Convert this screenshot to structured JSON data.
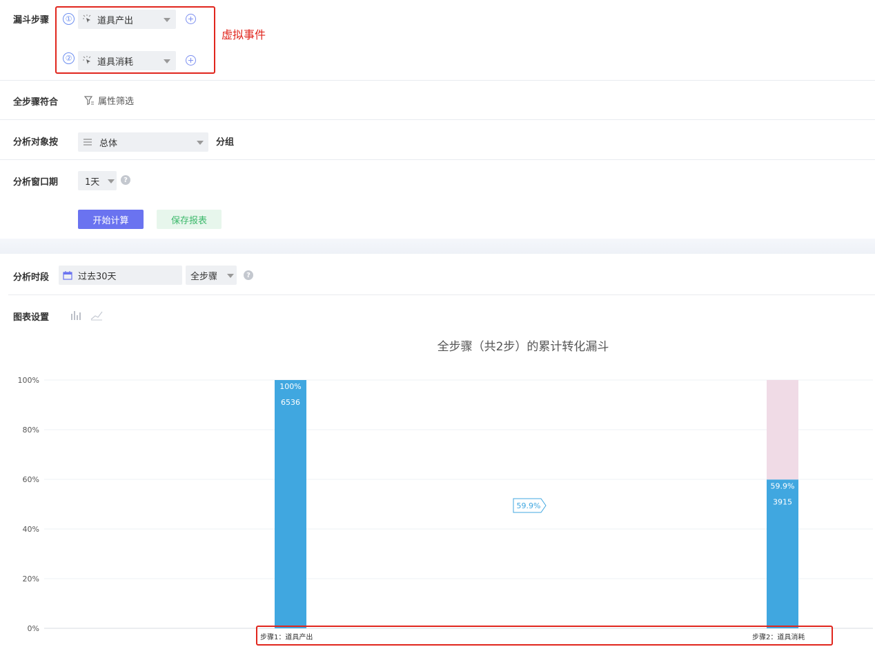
{
  "config": {
    "funnel_steps_label": "漏斗步骤",
    "steps": [
      {
        "index": "①",
        "name": "道具产出",
        "icon": "event-click-icon"
      },
      {
        "index": "②",
        "name": "道具消耗",
        "icon": "event-click-icon"
      }
    ],
    "annotation": "虚拟事件",
    "all_steps_match_label": "全步骤符合",
    "attribute_filter_label": "属性筛选",
    "group_by_label": "分析对象按",
    "group_by_value": "总体",
    "group_suffix": "分组",
    "window_label": "分析窗口期",
    "window_value": "1天",
    "help_glyph": "?",
    "calculate_button": "开始计算",
    "save_button": "保存报表"
  },
  "results": {
    "period_label": "分析时段",
    "period_value": "过去30天",
    "step_scope_value": "全步骤",
    "chart_settings_label": "图表设置"
  },
  "colors": {
    "accent": "#6a73f0",
    "bar": "#40a7e0",
    "bar_remainder": "#f0dbe6",
    "annotation_red": "#e0251c",
    "save_green": "#3bb86a"
  },
  "chart_data": {
    "type": "bar",
    "title": "全步骤（共2步）的累计转化漏斗",
    "categories": [
      "步骤1：道具产出",
      "步骤2：道具消耗"
    ],
    "series": [
      {
        "values": [
          100,
          59.9
        ],
        "counts": [
          6536,
          3915
        ],
        "value_labels": [
          "100%",
          "59.9%"
        ],
        "count_labels": [
          "6536",
          "3915"
        ]
      }
    ],
    "conversion_labels": [
      "59.9%"
    ],
    "y_ticks": [
      "0%",
      "20%",
      "40%",
      "60%",
      "80%",
      "100%"
    ],
    "ylim": [
      0,
      100
    ],
    "grid": true
  }
}
